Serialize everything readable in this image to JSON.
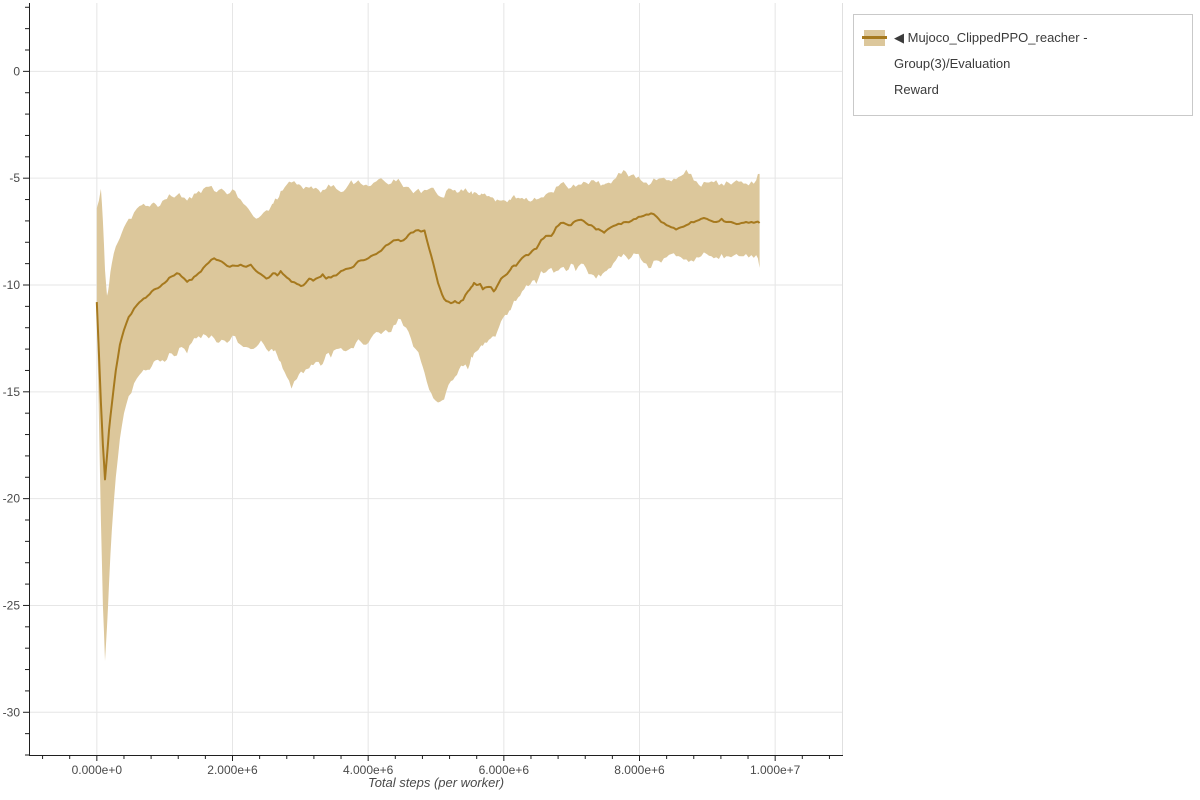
{
  "page": {
    "background": "#ffffff"
  },
  "legend": {
    "label": "◀ Mujoco_ClippedPPO_reacher - Group(3)/Evaluation Reward",
    "label_line1": "◀ Mujoco_ClippedPPO_reacher - Group(3)/Evaluation",
    "label_line2": "Reward",
    "border_color": "#c9c9c9"
  },
  "chart_data": {
    "type": "line",
    "title": "",
    "xlabel": "Total steps (per worker)",
    "ylabel": "",
    "x_unit": "steps (millions)",
    "xlim_e6": [
      -1.0,
      11.0
    ],
    "ylim": [
      -32,
      3.2
    ],
    "grid": true,
    "legend_position": "outside-right",
    "grid_color": "#e6e6e6",
    "axis_color": "#1f1f1f",
    "outline_color": "#e0e0e0",
    "tick_label_color": "#4a4a4a",
    "x_ticks": [
      {
        "v": 0,
        "label": "0.000e+0"
      },
      {
        "v": 2,
        "label": "2.000e+6"
      },
      {
        "v": 4,
        "label": "4.000e+6"
      },
      {
        "v": 6,
        "label": "6.000e+6"
      },
      {
        "v": 8,
        "label": "8.000e+6"
      },
      {
        "v": 10,
        "label": "1.000e+7"
      }
    ],
    "y_ticks": [
      {
        "v": 0,
        "label": "0"
      },
      {
        "v": -5,
        "label": "-5"
      },
      {
        "v": -10,
        "label": "-10"
      },
      {
        "v": -15,
        "label": "-15"
      },
      {
        "v": -20,
        "label": "-20"
      },
      {
        "v": -25,
        "label": "-25"
      },
      {
        "v": -30,
        "label": "-30"
      }
    ],
    "x_minor_step_e6": 0.4,
    "y_minor_step": 1,
    "series": [
      {
        "name": "Mujoco_ClippedPPO_reacher - Group(3)/Evaluation Reward",
        "line_color": "#a6791e",
        "band_color": "#dcc79b",
        "x_e6": [
          0.0,
          0.06,
          0.09,
          0.12,
          0.15,
          0.18,
          0.22,
          0.28,
          0.34,
          0.4,
          0.47,
          0.55,
          0.63,
          0.72,
          0.81,
          0.9,
          1.0,
          1.1,
          1.18,
          1.25,
          1.33,
          1.4,
          1.5,
          1.57,
          1.65,
          1.73,
          1.8,
          1.88,
          1.96,
          2.04,
          2.12,
          2.2,
          2.27,
          2.35,
          2.42,
          2.5,
          2.57,
          2.6,
          2.66,
          2.71,
          2.8,
          2.87,
          2.95,
          3.01,
          3.08,
          3.13,
          3.19,
          3.27,
          3.33,
          3.38,
          3.45,
          3.53,
          3.6,
          3.67,
          3.75,
          3.82,
          3.89,
          3.97,
          4.04,
          4.12,
          4.19,
          4.26,
          4.34,
          4.41,
          4.48,
          4.56,
          4.63,
          4.7,
          4.78,
          4.83,
          4.9,
          4.96,
          5.03,
          5.09,
          5.15,
          5.22,
          5.28,
          5.34,
          5.4,
          5.47,
          5.52,
          5.56,
          5.6,
          5.65,
          5.69,
          5.75,
          5.81,
          5.85,
          5.9,
          5.96,
          6.02,
          6.08,
          6.12,
          6.18,
          6.24,
          6.3,
          6.36,
          6.42,
          6.48,
          6.55,
          6.62,
          6.7,
          6.77,
          6.84,
          6.92,
          6.99,
          7.06,
          7.14,
          7.21,
          7.29,
          7.36,
          7.43,
          7.48,
          7.51,
          7.58,
          7.65,
          7.73,
          7.8,
          7.88,
          7.95,
          8.02,
          8.1,
          8.17,
          8.25,
          8.32,
          8.4,
          8.47,
          8.54,
          8.61,
          8.69,
          8.76,
          8.84,
          8.91,
          8.99,
          9.06,
          9.13,
          9.21,
          9.28,
          9.35,
          9.43,
          9.5,
          9.57,
          9.65,
          9.72,
          9.77
        ],
        "mean": [
          -10.8,
          -15.5,
          -17.5,
          -19.1,
          -18.0,
          -16.8,
          -15.6,
          -14.0,
          -12.8,
          -12.1,
          -11.5,
          -11.1,
          -10.8,
          -10.6,
          -10.3,
          -10.15,
          -9.9,
          -9.6,
          -9.45,
          -9.6,
          -9.85,
          -9.75,
          -9.45,
          -9.2,
          -8.95,
          -8.75,
          -8.85,
          -9.0,
          -9.15,
          -9.1,
          -9.05,
          -9.15,
          -9.05,
          -9.35,
          -9.5,
          -9.7,
          -9.55,
          -9.45,
          -9.55,
          -9.35,
          -9.65,
          -9.85,
          -9.95,
          -10.05,
          -9.9,
          -9.7,
          -9.8,
          -9.65,
          -9.5,
          -9.7,
          -9.65,
          -9.55,
          -9.35,
          -9.25,
          -9.2,
          -9.0,
          -8.85,
          -8.8,
          -8.65,
          -8.55,
          -8.4,
          -8.15,
          -8.0,
          -7.9,
          -7.95,
          -7.8,
          -7.55,
          -7.45,
          -7.5,
          -7.45,
          -8.3,
          -9.0,
          -9.9,
          -10.45,
          -10.75,
          -10.85,
          -10.75,
          -10.85,
          -10.7,
          -10.3,
          -10.1,
          -9.9,
          -10.0,
          -9.95,
          -10.2,
          -10.1,
          -10.1,
          -10.3,
          -10.05,
          -9.7,
          -9.55,
          -9.35,
          -9.15,
          -9.1,
          -8.85,
          -8.65,
          -8.6,
          -8.4,
          -8.3,
          -7.9,
          -7.7,
          -7.7,
          -7.3,
          -7.1,
          -7.15,
          -7.2,
          -7.0,
          -6.95,
          -7.1,
          -7.2,
          -7.4,
          -7.45,
          -7.55,
          -7.45,
          -7.3,
          -7.2,
          -7.15,
          -7.05,
          -7.0,
          -6.9,
          -6.8,
          -6.7,
          -6.65,
          -6.8,
          -7.05,
          -7.2,
          -7.3,
          -7.4,
          -7.3,
          -7.2,
          -7.05,
          -7.0,
          -6.9,
          -6.9,
          -7.0,
          -7.05,
          -6.9,
          -7.05,
          -7.05,
          -7.15,
          -7.1,
          -7.05,
          -7.05,
          -7.05,
          -7.1
        ],
        "band_high": [
          -6.4,
          -5.5,
          -7.0,
          -9.3,
          -10.5,
          -10.0,
          -9.0,
          -8.2,
          -7.8,
          -7.3,
          -6.9,
          -6.6,
          -6.3,
          -6.3,
          -6.2,
          -6.35,
          -6.0,
          -5.85,
          -5.8,
          -5.9,
          -6.05,
          -5.95,
          -5.6,
          -5.5,
          -5.4,
          -5.6,
          -5.55,
          -5.6,
          -5.7,
          -5.6,
          -6.0,
          -6.3,
          -6.6,
          -6.9,
          -6.75,
          -6.5,
          -6.3,
          -6.2,
          -6.0,
          -5.6,
          -5.3,
          -5.2,
          -5.3,
          -5.35,
          -5.4,
          -5.45,
          -5.5,
          -5.55,
          -5.55,
          -5.5,
          -5.4,
          -5.5,
          -5.65,
          -5.5,
          -5.1,
          -5.2,
          -5.25,
          -5.3,
          -5.35,
          -5.15,
          -5.0,
          -5.2,
          -5.25,
          -5.15,
          -5.2,
          -5.4,
          -5.55,
          -5.6,
          -5.7,
          -5.55,
          -5.5,
          -5.45,
          -5.8,
          -5.9,
          -5.6,
          -5.5,
          -5.55,
          -5.65,
          -5.6,
          -5.65,
          -5.6,
          -5.65,
          -5.7,
          -5.8,
          -5.75,
          -5.85,
          -5.9,
          -5.95,
          -6.0,
          -6.05,
          -6.05,
          -6.0,
          -5.9,
          -5.95,
          -5.95,
          -6.0,
          -6.05,
          -6.05,
          -6.0,
          -5.9,
          -5.75,
          -5.65,
          -5.4,
          -5.25,
          -5.35,
          -5.45,
          -5.4,
          -5.3,
          -5.2,
          -5.1,
          -5.2,
          -5.35,
          -5.3,
          -5.25,
          -5.25,
          -5.0,
          -4.8,
          -4.7,
          -4.85,
          -5.0,
          -5.1,
          -5.2,
          -5.25,
          -5.1,
          -5.0,
          -5.1,
          -5.15,
          -5.05,
          -4.9,
          -4.6,
          -4.8,
          -5.15,
          -5.4,
          -5.2,
          -5.15,
          -5.1,
          -5.25,
          -5.15,
          -5.3,
          -5.1,
          -5.15,
          -5.25,
          -5.15,
          -5.1,
          -4.8
        ],
        "band_low": [
          -11.2,
          -21.0,
          -25.0,
          -27.6,
          -26.0,
          -24.0,
          -21.5,
          -19.0,
          -17.2,
          -16.0,
          -15.2,
          -14.6,
          -14.2,
          -14.0,
          -13.8,
          -13.5,
          -13.6,
          -13.2,
          -13.3,
          -12.9,
          -13.2,
          -12.7,
          -12.4,
          -12.3,
          -12.5,
          -12.5,
          -12.7,
          -12.6,
          -12.6,
          -12.4,
          -12.8,
          -12.9,
          -13.0,
          -12.9,
          -12.6,
          -13.0,
          -13.0,
          -13.1,
          -13.3,
          -13.6,
          -14.3,
          -14.85,
          -14.4,
          -14.05,
          -13.95,
          -13.9,
          -13.75,
          -13.6,
          -13.7,
          -13.25,
          -13.4,
          -13.0,
          -12.95,
          -13.1,
          -12.95,
          -12.7,
          -12.65,
          -12.8,
          -12.5,
          -12.2,
          -12.3,
          -12.1,
          -12.2,
          -11.85,
          -11.6,
          -12.0,
          -12.5,
          -13.0,
          -13.6,
          -14.1,
          -14.9,
          -15.3,
          -15.5,
          -15.4,
          -15.0,
          -14.5,
          -14.3,
          -13.95,
          -13.8,
          -13.95,
          -13.35,
          -13.2,
          -13.1,
          -12.9,
          -12.85,
          -12.7,
          -12.5,
          -12.4,
          -12.2,
          -11.7,
          -11.4,
          -11.2,
          -11.0,
          -10.75,
          -10.5,
          -10.2,
          -10.05,
          -9.8,
          -9.95,
          -9.35,
          -9.4,
          -9.2,
          -9.35,
          -9.2,
          -9.35,
          -9.0,
          -9.35,
          -9.0,
          -9.2,
          -9.5,
          -9.7,
          -9.6,
          -9.4,
          -9.35,
          -9.2,
          -8.85,
          -8.7,
          -8.65,
          -8.7,
          -8.55,
          -8.8,
          -9.0,
          -9.2,
          -8.85,
          -8.95,
          -8.7,
          -8.55,
          -8.65,
          -8.7,
          -8.8,
          -8.85,
          -8.7,
          -8.65,
          -8.55,
          -8.65,
          -8.7,
          -8.55,
          -8.65,
          -8.7,
          -8.55,
          -8.65,
          -8.55,
          -8.6,
          -8.6,
          -9.2
        ]
      }
    ]
  }
}
